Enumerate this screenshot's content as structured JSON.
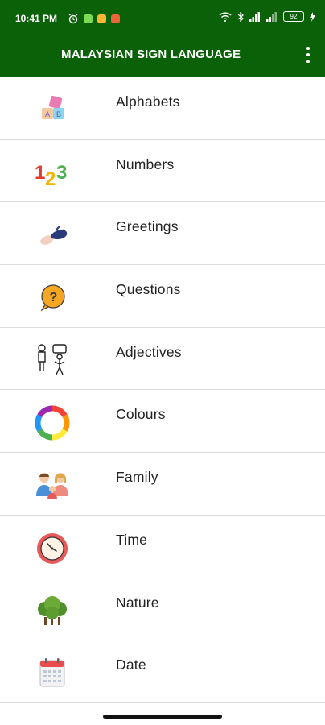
{
  "status_bar": {
    "time": "10:41 PM",
    "battery": "92"
  },
  "app_bar": {
    "title": "MALAYSIAN SIGN LANGUAGE",
    "menu_icon": "more-vert-icon"
  },
  "categories": [
    {
      "label": "Alphabets",
      "icon": "alphabet-blocks-icon"
    },
    {
      "label": "Numbers",
      "icon": "numbers-123-icon"
    },
    {
      "label": "Greetings",
      "icon": "waving-hands-icon"
    },
    {
      "label": "Questions",
      "icon": "question-bubble-icon"
    },
    {
      "label": "Adjectives",
      "icon": "people-expressions-icon"
    },
    {
      "label": "Colours",
      "icon": "color-wheel-icon"
    },
    {
      "label": "Family",
      "icon": "family-icon"
    },
    {
      "label": "Time",
      "icon": "clock-icon"
    },
    {
      "label": "Nature",
      "icon": "trees-icon"
    },
    {
      "label": "Date",
      "icon": "calendar-icon"
    }
  ],
  "colors": {
    "app_bar": "#0b6108",
    "divider": "#dcdcdc",
    "text": "#222222"
  }
}
